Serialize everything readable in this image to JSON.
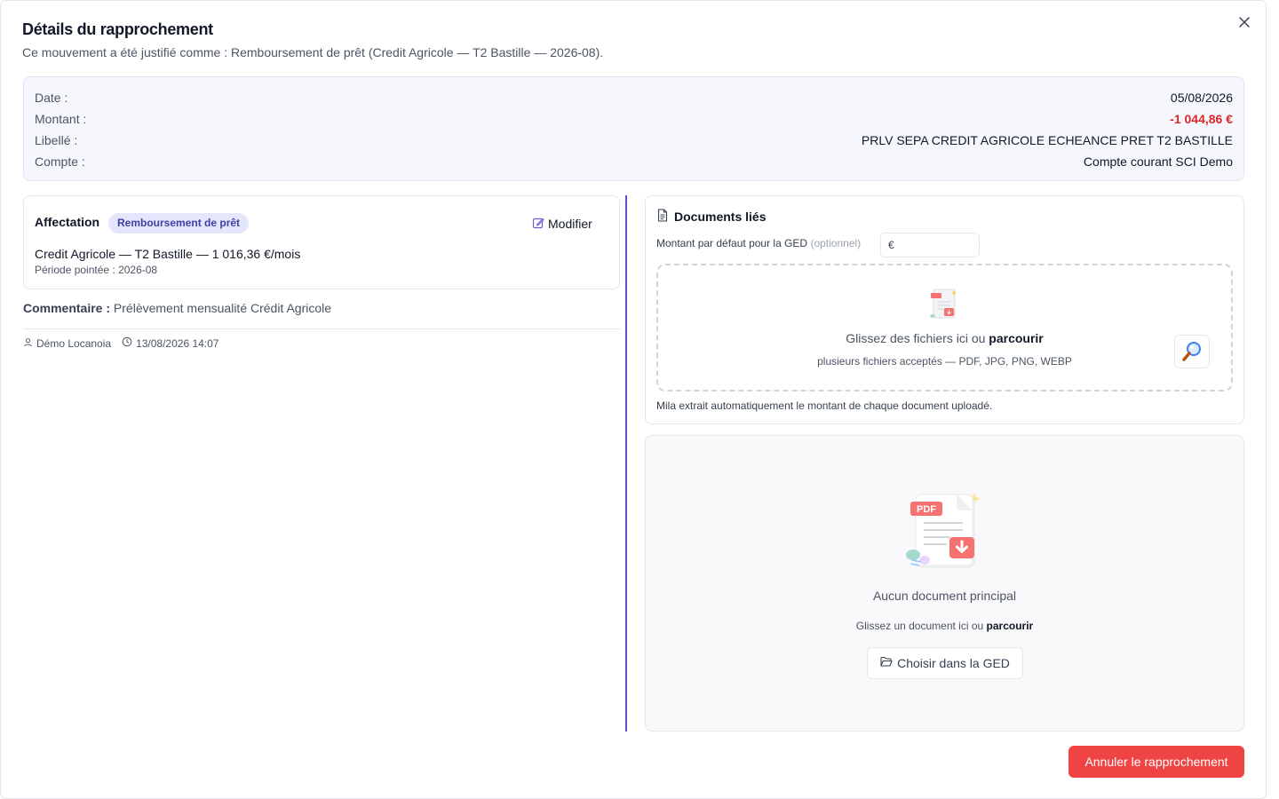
{
  "dialog": {
    "title": "Détails du rapprochement",
    "subtitle": "Ce mouvement a été justifié comme : Remboursement de prêt (Credit Agricole — T2 Bastille — 2026-08).",
    "close_icon": "close-icon"
  },
  "summary": {
    "rows": [
      {
        "label": "Date :",
        "value": "05/08/2026"
      },
      {
        "label": "Montant :",
        "value": "-1 044,86 €"
      },
      {
        "label": "Libellé :",
        "value": "PRLV SEPA CREDIT AGRICOLE ECHEANCE PRET T2 BASTILLE"
      },
      {
        "label": "Compte :",
        "value": "Compte courant SCI Demo"
      }
    ],
    "negative_color": "#dc2626"
  },
  "affectation": {
    "title": "Affectation",
    "badge": "Remboursement de prêt",
    "modify_label": "Modifier",
    "loan": "Credit Agricole — T2 Bastille — 1 016,36 €/mois",
    "period": "Période pointée : 2026-08"
  },
  "comment": {
    "label": "Commentaire :",
    "text": "Prélèvement mensualité Crédit Agricole"
  },
  "meta": {
    "user": "Démo Locanoia",
    "datetime": "13/08/2026 14:07"
  },
  "documents": {
    "title": "Documents liés",
    "amount_label": "Montant par défaut pour la GED",
    "amount_optional": "(optionnel)",
    "amount_currency": "€",
    "amount_value": "",
    "dropzone_text": "Glissez des fichiers ici ou",
    "dropzone_link": "parcourir",
    "dropzone_sub": "plusieurs fichiers acceptés — PDF, JPG, PNG, WEBP",
    "mila_note": "Mila extrait automatiquement le montant de chaque document uploadé."
  },
  "main_document": {
    "pdf_badge": "PDF",
    "empty_text": "Aucun document principal",
    "drop_text": "Glissez un document ici ou",
    "drop_link": "parcourir",
    "ged_button": "Choisir dans la GED"
  },
  "footer": {
    "cancel_button": "Annuler le rapprochement"
  },
  "colors": {
    "accent": "#5b4fd6",
    "danger": "#ef4444",
    "badge_bg": "#e4e6fb",
    "badge_text": "#3f3fa8"
  }
}
